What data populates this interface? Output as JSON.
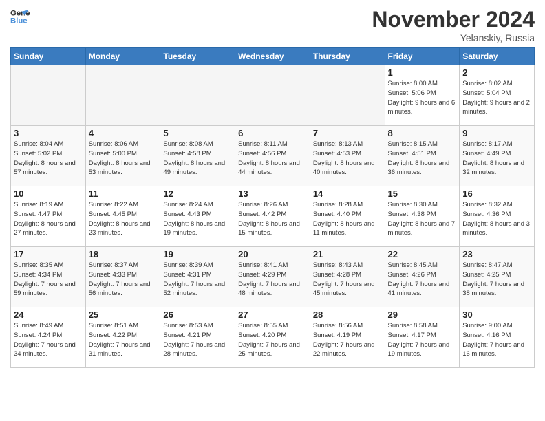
{
  "header": {
    "logo_line1": "General",
    "logo_line2": "Blue",
    "month": "November 2024",
    "location": "Yelanskiy, Russia"
  },
  "weekdays": [
    "Sunday",
    "Monday",
    "Tuesday",
    "Wednesday",
    "Thursday",
    "Friday",
    "Saturday"
  ],
  "weeks": [
    [
      {
        "day": "",
        "info": ""
      },
      {
        "day": "",
        "info": ""
      },
      {
        "day": "",
        "info": ""
      },
      {
        "day": "",
        "info": ""
      },
      {
        "day": "",
        "info": ""
      },
      {
        "day": "1",
        "info": "Sunrise: 8:00 AM\nSunset: 5:06 PM\nDaylight: 9 hours\nand 6 minutes."
      },
      {
        "day": "2",
        "info": "Sunrise: 8:02 AM\nSunset: 5:04 PM\nDaylight: 9 hours\nand 2 minutes."
      }
    ],
    [
      {
        "day": "3",
        "info": "Sunrise: 8:04 AM\nSunset: 5:02 PM\nDaylight: 8 hours\nand 57 minutes."
      },
      {
        "day": "4",
        "info": "Sunrise: 8:06 AM\nSunset: 5:00 PM\nDaylight: 8 hours\nand 53 minutes."
      },
      {
        "day": "5",
        "info": "Sunrise: 8:08 AM\nSunset: 4:58 PM\nDaylight: 8 hours\nand 49 minutes."
      },
      {
        "day": "6",
        "info": "Sunrise: 8:11 AM\nSunset: 4:56 PM\nDaylight: 8 hours\nand 44 minutes."
      },
      {
        "day": "7",
        "info": "Sunrise: 8:13 AM\nSunset: 4:53 PM\nDaylight: 8 hours\nand 40 minutes."
      },
      {
        "day": "8",
        "info": "Sunrise: 8:15 AM\nSunset: 4:51 PM\nDaylight: 8 hours\nand 36 minutes."
      },
      {
        "day": "9",
        "info": "Sunrise: 8:17 AM\nSunset: 4:49 PM\nDaylight: 8 hours\nand 32 minutes."
      }
    ],
    [
      {
        "day": "10",
        "info": "Sunrise: 8:19 AM\nSunset: 4:47 PM\nDaylight: 8 hours\nand 27 minutes."
      },
      {
        "day": "11",
        "info": "Sunrise: 8:22 AM\nSunset: 4:45 PM\nDaylight: 8 hours\nand 23 minutes."
      },
      {
        "day": "12",
        "info": "Sunrise: 8:24 AM\nSunset: 4:43 PM\nDaylight: 8 hours\nand 19 minutes."
      },
      {
        "day": "13",
        "info": "Sunrise: 8:26 AM\nSunset: 4:42 PM\nDaylight: 8 hours\nand 15 minutes."
      },
      {
        "day": "14",
        "info": "Sunrise: 8:28 AM\nSunset: 4:40 PM\nDaylight: 8 hours\nand 11 minutes."
      },
      {
        "day": "15",
        "info": "Sunrise: 8:30 AM\nSunset: 4:38 PM\nDaylight: 8 hours\nand 7 minutes."
      },
      {
        "day": "16",
        "info": "Sunrise: 8:32 AM\nSunset: 4:36 PM\nDaylight: 8 hours\nand 3 minutes."
      }
    ],
    [
      {
        "day": "17",
        "info": "Sunrise: 8:35 AM\nSunset: 4:34 PM\nDaylight: 7 hours\nand 59 minutes."
      },
      {
        "day": "18",
        "info": "Sunrise: 8:37 AM\nSunset: 4:33 PM\nDaylight: 7 hours\nand 56 minutes."
      },
      {
        "day": "19",
        "info": "Sunrise: 8:39 AM\nSunset: 4:31 PM\nDaylight: 7 hours\nand 52 minutes."
      },
      {
        "day": "20",
        "info": "Sunrise: 8:41 AM\nSunset: 4:29 PM\nDaylight: 7 hours\nand 48 minutes."
      },
      {
        "day": "21",
        "info": "Sunrise: 8:43 AM\nSunset: 4:28 PM\nDaylight: 7 hours\nand 45 minutes."
      },
      {
        "day": "22",
        "info": "Sunrise: 8:45 AM\nSunset: 4:26 PM\nDaylight: 7 hours\nand 41 minutes."
      },
      {
        "day": "23",
        "info": "Sunrise: 8:47 AM\nSunset: 4:25 PM\nDaylight: 7 hours\nand 38 minutes."
      }
    ],
    [
      {
        "day": "24",
        "info": "Sunrise: 8:49 AM\nSunset: 4:24 PM\nDaylight: 7 hours\nand 34 minutes."
      },
      {
        "day": "25",
        "info": "Sunrise: 8:51 AM\nSunset: 4:22 PM\nDaylight: 7 hours\nand 31 minutes."
      },
      {
        "day": "26",
        "info": "Sunrise: 8:53 AM\nSunset: 4:21 PM\nDaylight: 7 hours\nand 28 minutes."
      },
      {
        "day": "27",
        "info": "Sunrise: 8:55 AM\nSunset: 4:20 PM\nDaylight: 7 hours\nand 25 minutes."
      },
      {
        "day": "28",
        "info": "Sunrise: 8:56 AM\nSunset: 4:19 PM\nDaylight: 7 hours\nand 22 minutes."
      },
      {
        "day": "29",
        "info": "Sunrise: 8:58 AM\nSunset: 4:17 PM\nDaylight: 7 hours\nand 19 minutes."
      },
      {
        "day": "30",
        "info": "Sunrise: 9:00 AM\nSunset: 4:16 PM\nDaylight: 7 hours\nand 16 minutes."
      }
    ]
  ]
}
